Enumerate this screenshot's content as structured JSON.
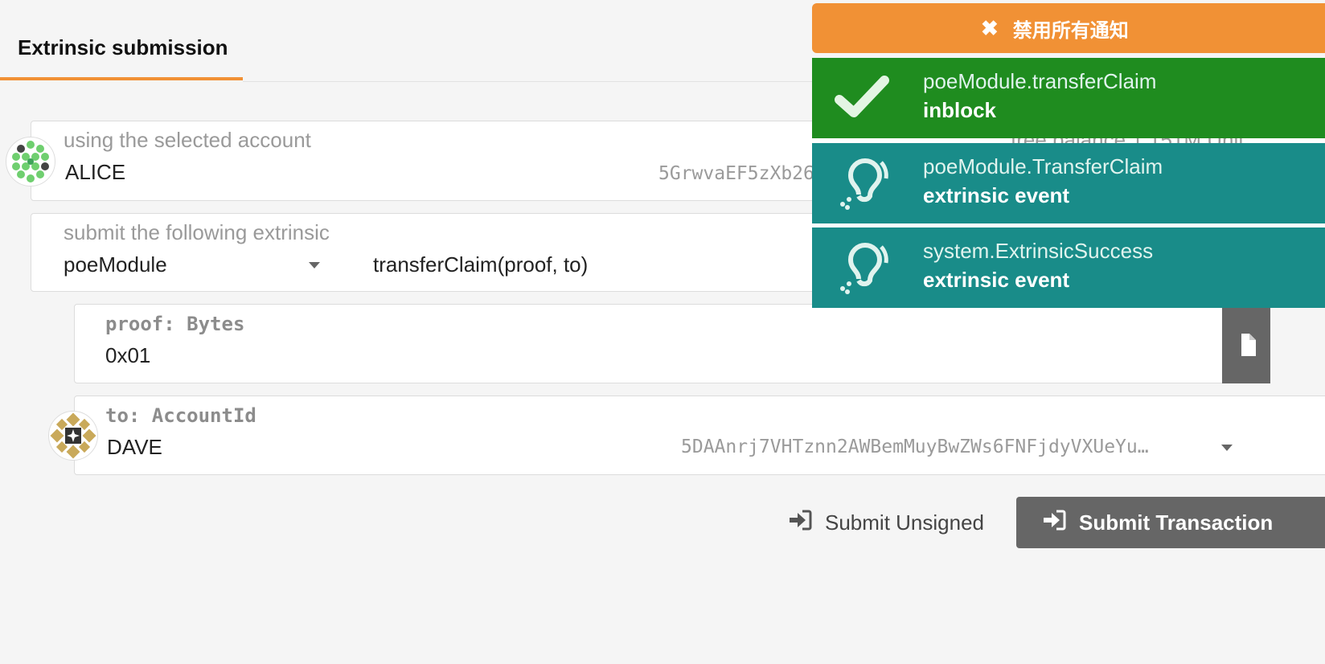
{
  "header": {
    "tab_title": "Extrinsic submission"
  },
  "account": {
    "label": "using the selected account",
    "name": "ALICE",
    "address": "5GrwvaEF5zXb26Fz9rcQpDWS57CtERHpNehXCPcNoHG",
    "balance_text": "free balance 1.151M Unit"
  },
  "extrinsic": {
    "label": "submit the following extrinsic",
    "module": "poeModule",
    "call": "transferClaim(proof, to)",
    "call_short": "transferClaim"
  },
  "params": {
    "proof": {
      "label": "proof: Bytes",
      "value": "0x01"
    },
    "to": {
      "label": "to: AccountId",
      "name": "DAVE",
      "address": "5DAAnrj7VHTznn2AWBemMuyBwZWs6FNFjdyVXUeYu…"
    }
  },
  "buttons": {
    "submit_unsigned": "Submit Unsigned",
    "submit_transaction": "Submit Transaction"
  },
  "notifications": {
    "clear_all": "禁用所有通知",
    "items": [
      {
        "title": "poeModule.transferClaim",
        "status": "inblock",
        "icon": "check-icon",
        "color": "#1f8c1f"
      },
      {
        "title": "poeModule.TransferClaim",
        "status": "extrinsic event",
        "icon": "ear-icon",
        "color": "#198c89"
      },
      {
        "title": "system.ExtrinsicSuccess",
        "status": "extrinsic event",
        "icon": "ear-icon",
        "color": "#198c89"
      }
    ]
  },
  "colors": {
    "accent": "#f19135",
    "success": "#1f8c1f",
    "event": "#198c89",
    "button": "#666666"
  }
}
